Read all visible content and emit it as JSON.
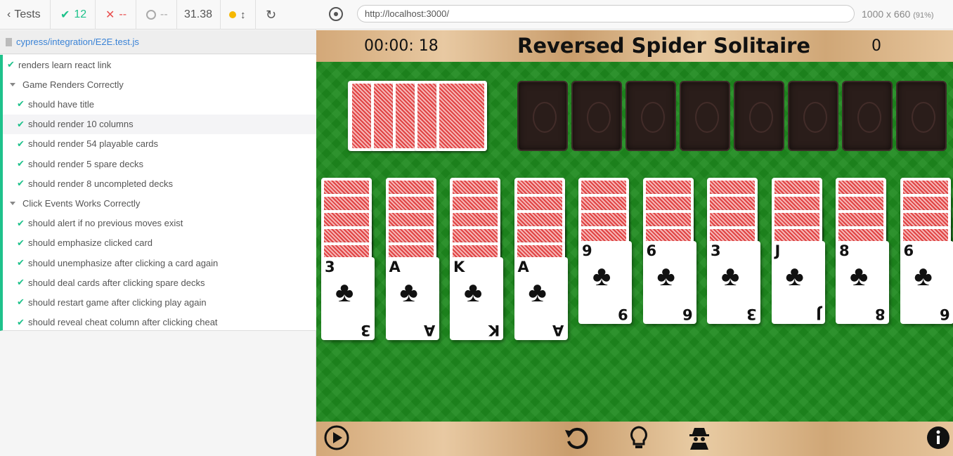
{
  "reporter": {
    "tests_label": "Tests",
    "passed": "12",
    "failed": "--",
    "pending": "--",
    "duration": "31.38",
    "spec_file": "cypress/integration/E2E.test.js",
    "tests": [
      {
        "type": "test",
        "label": "renders learn react link"
      },
      {
        "type": "suite",
        "label": "Game Renders Correctly"
      },
      {
        "type": "test",
        "label": "should have title"
      },
      {
        "type": "test",
        "label": "should render 10 columns"
      },
      {
        "type": "test",
        "label": "should render 54 playable cards"
      },
      {
        "type": "test",
        "label": "should render 5 spare decks"
      },
      {
        "type": "test",
        "label": "should render 8 uncompleted decks"
      },
      {
        "type": "suite",
        "label": "Click Events Works Correctly"
      },
      {
        "type": "test",
        "label": "should alert if no previous moves exist"
      },
      {
        "type": "test",
        "label": "should emphasize clicked card"
      },
      {
        "type": "test",
        "label": "should unemphasize after clicking a card again"
      },
      {
        "type": "test",
        "label": "should deal cards after clicking spare decks"
      },
      {
        "type": "test",
        "label": "should restart game after clicking play again"
      },
      {
        "type": "test",
        "label": "should reveal cheat column after clicking cheat"
      }
    ]
  },
  "browser": {
    "url": "http://localhost:3000/",
    "viewport": "1000 x 660",
    "zoom": "(91%)"
  },
  "game": {
    "timer": "00:00: 18",
    "title": "Reversed Spider Solitaire",
    "score": "0",
    "spare_decks": 5,
    "uncompleted_decks": 8,
    "columns": [
      {
        "hidden": 5,
        "top": "3"
      },
      {
        "hidden": 5,
        "top": "A"
      },
      {
        "hidden": 5,
        "top": "K"
      },
      {
        "hidden": 5,
        "top": "A"
      },
      {
        "hidden": 4,
        "top": "9"
      },
      {
        "hidden": 4,
        "top": "6"
      },
      {
        "hidden": 4,
        "top": "3"
      },
      {
        "hidden": 4,
        "top": "J"
      },
      {
        "hidden": 4,
        "top": "8"
      },
      {
        "hidden": 4,
        "top": "6"
      }
    ],
    "suit_symbol": "♣"
  },
  "colors": {
    "accent": "#1ec28b",
    "felt": "#1e8a1e",
    "card_back": "#e04343"
  }
}
